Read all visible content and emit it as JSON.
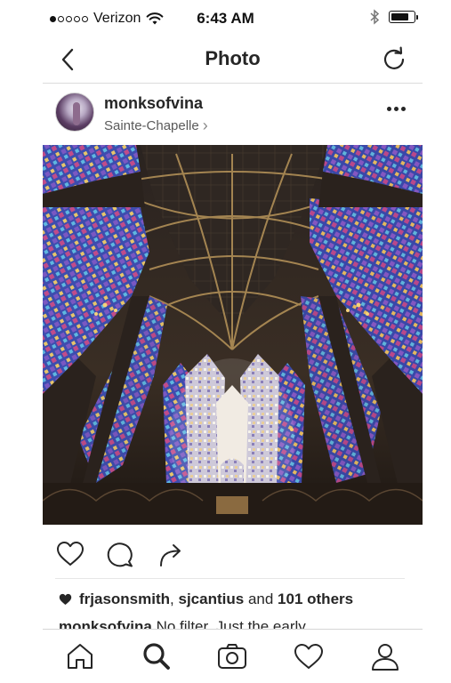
{
  "status_bar": {
    "carrier": "Verizon",
    "time": "6:43 AM",
    "signal_bars_filled": 1,
    "signal_bars_total": 5,
    "battery_level": 0.8
  },
  "nav": {
    "title": "Photo",
    "back_icon": "chevron-left-icon",
    "refresh_icon": "refresh-icon"
  },
  "post": {
    "username": "monksofvina",
    "location": "Sainte-Chapelle",
    "location_chevron": "›",
    "photo_subject": "cathedral-stained-glass-photo"
  },
  "actions": {
    "like_icon": "heart-icon",
    "comment_icon": "comment-icon",
    "share_icon": "share-icon"
  },
  "likes": {
    "user1": "frjasonsmith",
    "sep": ",",
    "user2": "sjcantius",
    "and": "and",
    "others": "101 others"
  },
  "caption": {
    "username": "monksofvina",
    "text": "No filter. Just the early"
  },
  "tab_bar": {
    "items": [
      "home-icon",
      "search-icon",
      "camera-icon",
      "heart-icon",
      "profile-icon"
    ],
    "active": "search-icon"
  },
  "colors": {
    "text": "#262626",
    "secondary": "#5a5a5a",
    "divider": "#dbdbdb",
    "glass_blue": "#3b4fb0",
    "glass_purple": "#6a3f9e"
  }
}
